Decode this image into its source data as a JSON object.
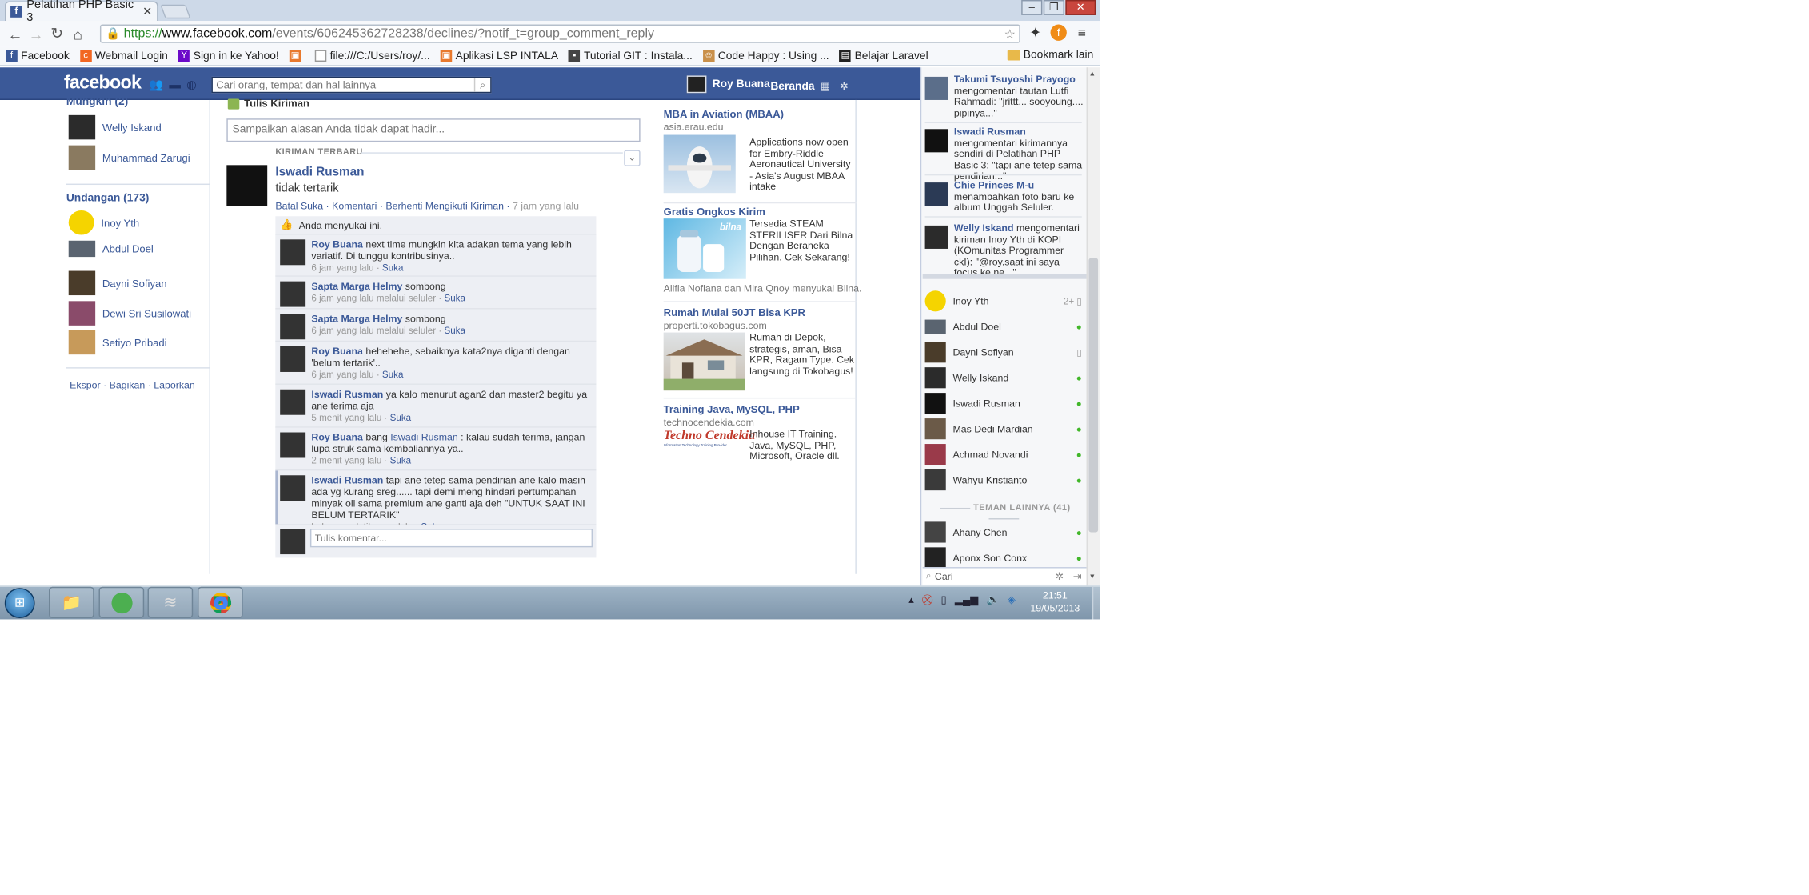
{
  "browser": {
    "tab_title": "Pelatihan PHP Basic 3",
    "tab_favicon": "f",
    "url_scheme": "https://",
    "url_host": "www.facebook.com",
    "url_path": "/events/606245362728238/declines/?notif_t=group_comment_reply",
    "bookmarks": [
      {
        "label": "Facebook",
        "icon": "facebook-icon",
        "color": "#3b5998"
      },
      {
        "label": "Webmail Login",
        "icon": "cpanel-icon",
        "color": "#f26722"
      },
      {
        "label": "Sign in ke Yahoo!",
        "icon": "yahoo-icon",
        "color": "#6b0ac9"
      },
      {
        "label": "",
        "icon": "orange-square-icon",
        "color": "#e8792d"
      },
      {
        "label": "file:///C:/Users/roy/...",
        "icon": "file-icon",
        "color": "#ffffff"
      },
      {
        "label": "Aplikasi LSP INTALA",
        "icon": "orange-square-icon",
        "color": "#e8792d"
      },
      {
        "label": "Tutorial GIT : Instala...",
        "icon": "git-icon",
        "color": "#444444"
      },
      {
        "label": "Code Happy : Using ...",
        "icon": "codehappy-icon",
        "color": "#c9904a"
      },
      {
        "label": "Belajar Laravel",
        "icon": "laravel-icon",
        "color": "#222222"
      }
    ],
    "bookmark_folder": "Bookmark lain"
  },
  "fb": {
    "logo": "facebook",
    "search_placeholder": "Cari orang, tempat dan hal lainnya",
    "user_name": "Roy Buana",
    "home_label": "Beranda"
  },
  "left": {
    "section1_title": "Mungkin (2)",
    "maybe": [
      {
        "name": "Welly Iskand",
        "color": "#2b2b2b"
      },
      {
        "name": "Muhammad Zarugi",
        "color": "#8a7a60"
      }
    ],
    "section2_title": "Undangan (173)",
    "invites": [
      {
        "name": "Inoy Yth",
        "color": "#f5d400"
      },
      {
        "name": "Abdul Doel",
        "color": "#5a6470"
      },
      {
        "name": "Dayni Sofiyan",
        "color": "#4a3c2a"
      },
      {
        "name": "Dewi Sri Susilowati",
        "color": "#8a4b6a"
      },
      {
        "name": "Setiyo Pribadi",
        "color": "#c79a5a"
      }
    ],
    "links": [
      "Ekspor",
      "Bagikan",
      "Laporkan"
    ]
  },
  "post": {
    "composer_heading": "Tulis Kiriman",
    "composer_placeholder": "Sampaikan alasan Anda tidak dapat hadir...",
    "section_label": "KIRIMAN TERBARU",
    "author": "Iswadi Rusman",
    "text": "tidak tertarik",
    "actions": [
      "Batal Suka",
      "Komentari",
      "Berhenti Mengikuti Kiriman"
    ],
    "time": "7 jam yang lalu",
    "likes_text": "Anda menyukai ini.",
    "comments": [
      {
        "name": "Roy Buana",
        "text": "next time mungkin kita adakan tema yang lebih variatif. Di tunggu kontribusinya..",
        "meta": "6 jam yang lalu",
        "like": "Suka"
      },
      {
        "name": "Sapta Marga Helmy",
        "text": "sombong",
        "meta": "6 jam yang lalu melalui seluler",
        "like": "Suka"
      },
      {
        "name": "Sapta Marga Helmy",
        "text": "sombong",
        "meta": "6 jam yang lalu melalui seluler",
        "like": "Suka"
      },
      {
        "name": "Roy Buana",
        "text": "hehehehe, sebaiknya kata2nya diganti dengan 'belum tertarik'..",
        "meta": "6 jam yang lalu",
        "like": "Suka"
      },
      {
        "name": "Iswadi Rusman",
        "text": "ya kalo menurut agan2 dan master2 begitu ya ane terima aja",
        "meta": "5 menit yang lalu",
        "like": "Suka"
      },
      {
        "name": "Roy Buana",
        "text_pre": "bang ",
        "mention": "Iswadi Rusman",
        "text": " : kalau sudah terima, jangan lupa struk sama kembaliannya ya..",
        "meta": "2 menit yang lalu",
        "like": "Suka"
      },
      {
        "name": "Iswadi Rusman",
        "text": "tapi ane tetep sama pendirian ane kalo masih ada yg kurang sreg...... tapi demi meng hindari pertumpahan minyak oli sama premium ane ganti aja deh \"UNTUK SAAT INI BELUM TERTARIK\"",
        "meta": "beberapa detik yang lalu",
        "like": "Suka"
      }
    ],
    "comment_placeholder": "Tulis komentar..."
  },
  "ads": [
    {
      "title": "MBA in Aviation (MBAA)",
      "site": "asia.erau.edu",
      "text": "Applications now open for Embry-Riddle Aeronautical University - Asia's August MBAA intake",
      "image": "airplane-image",
      "image_color": "#8fb4d8"
    },
    {
      "title": "Gratis Ongkos Kirim",
      "site": "",
      "text": "Tersedia STEAM STERILISER Dari Bilna Dengan Beraneka Pilihan. Cek Sekarang!",
      "social": "Alifia Nofiana dan Mira Qnoy menyukai Bilna.",
      "image": "sterilizer-image",
      "image_color": "#7ec5e6",
      "image_text": "bilna"
    },
    {
      "title": "Rumah Mulai 50JT Bisa KPR",
      "site": "properti.tokobagus.com",
      "text": "Rumah di Depok, strategis, aman, Bisa KPR, Ragam Type. Cek langsung di Tokobagus!",
      "image": "house-image",
      "image_color": "#b9b1a0"
    },
    {
      "title": "Training Java, MySQL, PHP",
      "site": "technocendekia.com",
      "text": "Inhouse IT Training. Java, MySQL, PHP, Microsoft, Oracle dll.",
      "image": "techno-cendekia-logo",
      "image_color": "#ffffff",
      "image_text": "Techno Cendekia",
      "image_subtext": "Information Technology Training Provider"
    }
  ],
  "ticker": [
    {
      "name": "Takumi Tsuyoshi Prayogo",
      "text": "mengomentari tautan Lutfi Rahmadi: \"jrittt... sooyoung.... pipinya...\"",
      "color": "#5b6e8a"
    },
    {
      "name": "Iswadi Rusman",
      "text": "mengomentari kirimannya sendiri di Pelatihan PHP Basic 3: \"tapi ane tetep sama pendirian...\"",
      "color": "#111111"
    },
    {
      "name": "Chie Princes M-u",
      "text": "menambahkan foto baru ke album Unggah Seluler.",
      "color": "#2b3a55"
    },
    {
      "name": "Welly Iskand",
      "text": "mengomentari kiriman Inoy Yth di KOPI (KOmunitas Programmer ckI): \"@roy.saat ini saya focus ke ne...\"",
      "color": "#2b2b2b"
    }
  ],
  "chat": {
    "online": [
      {
        "name": "Inoy Yth",
        "status": "2+",
        "device": "mobile",
        "color": "#f5d400"
      },
      {
        "name": "Abdul Doel",
        "status": "",
        "device": "online",
        "color": "#5a6470"
      },
      {
        "name": "Dayni Sofiyan",
        "status": "",
        "device": "mobile",
        "color": "#4a3c2a"
      },
      {
        "name": "Welly Iskand",
        "status": "",
        "device": "online",
        "color": "#2b2b2b"
      },
      {
        "name": "Iswadi Rusman",
        "status": "",
        "device": "online",
        "color": "#111111"
      },
      {
        "name": "Mas Dedi Mardian",
        "status": "",
        "device": "online",
        "color": "#6b5a48"
      },
      {
        "name": "Achmad Novandi",
        "status": "",
        "device": "online",
        "color": "#9a3a4a"
      },
      {
        "name": "Wahyu Kristianto",
        "status": "",
        "device": "online",
        "color": "#3a3a3a"
      }
    ],
    "others_label": "TEMAN LAINNYA (41)",
    "others": [
      {
        "name": "Ahany Chen",
        "status": "",
        "device": "online",
        "color": "#444444"
      },
      {
        "name": "Aponx Son Conx",
        "status": "",
        "device": "online",
        "color": "#222222"
      }
    ],
    "search_placeholder": "Cari"
  },
  "taskbar": {
    "time": "21:51",
    "date": "19/05/2013"
  }
}
